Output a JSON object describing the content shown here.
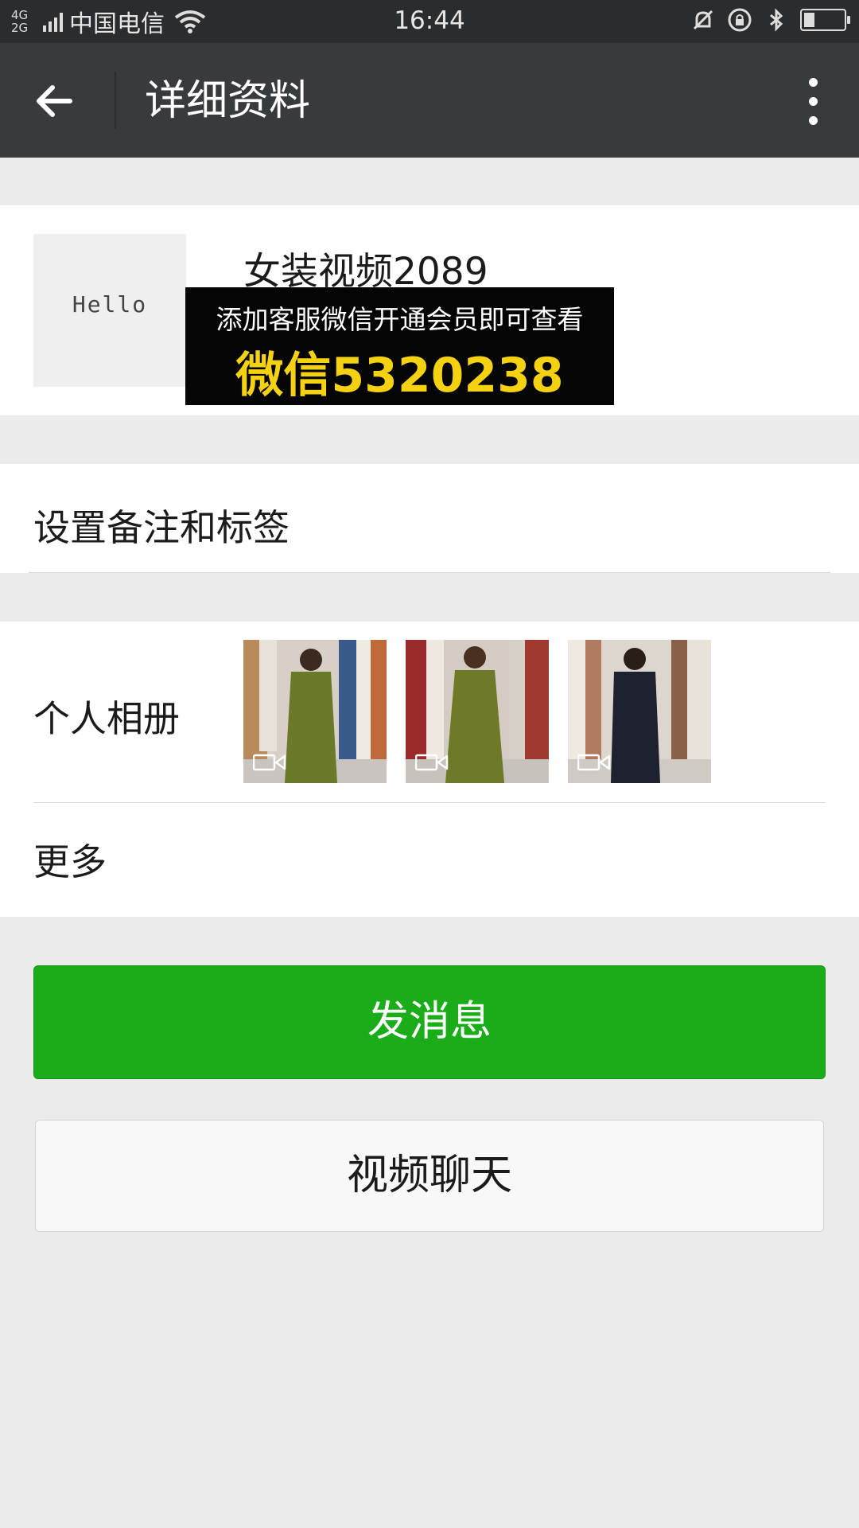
{
  "status_bar": {
    "network": "4G 2G",
    "carrier": "中国电信",
    "time": "16:44",
    "battery_level": 0.3
  },
  "nav": {
    "title": "详细资料",
    "back_icon": "arrow-left-icon",
    "more_icon": "more-vertical-icon"
  },
  "profile": {
    "avatar_text": "Hello",
    "name": "女装视频2089",
    "overlay": {
      "line1": "添加客服微信开通会员即可查看",
      "line2": "微信5320238",
      "line2_color": "#f5d211"
    }
  },
  "remark": {
    "label": "设置备注和标签"
  },
  "album": {
    "label": "个人相册",
    "items": [
      {
        "type": "video",
        "icon": "video-camera-icon"
      },
      {
        "type": "video",
        "icon": "video-camera-icon"
      },
      {
        "type": "video",
        "icon": "video-camera-icon"
      }
    ]
  },
  "more": {
    "label": "更多"
  },
  "actions": {
    "send_label": "发消息",
    "send_color": "#1aad19",
    "video_label": "视频聊天"
  }
}
